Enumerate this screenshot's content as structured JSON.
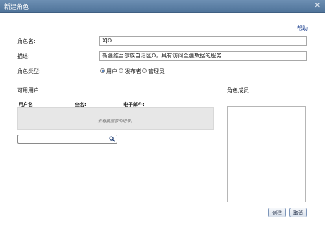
{
  "window": {
    "title": "新建角色",
    "close_glyph": "✕"
  },
  "help": {
    "label": "帮助"
  },
  "form": {
    "role_name_label": "角色名:",
    "role_name_value": "XJO",
    "description_label": "描述:",
    "description_value": "新疆维吾尔族自治区O，具有访问全疆数据的服务",
    "role_type_label": "角色类型:",
    "role_types": [
      {
        "label": "用户",
        "selected": true
      },
      {
        "label": "发布者",
        "selected": false
      },
      {
        "label": "管理员",
        "selected": false
      }
    ]
  },
  "available_users": {
    "title": "可用用户",
    "columns": [
      "用户名",
      "全名:",
      "电子邮件:"
    ],
    "empty_message": "没有要显示的记录。",
    "search_icon": "search-icon"
  },
  "members": {
    "title": "角色成员"
  },
  "buttons": {
    "create": "创建",
    "cancel": "取消"
  },
  "colors": {
    "titlebar": "#5a7ea5",
    "link": "#1b3f8f",
    "table_body": "#e7e7e7"
  }
}
